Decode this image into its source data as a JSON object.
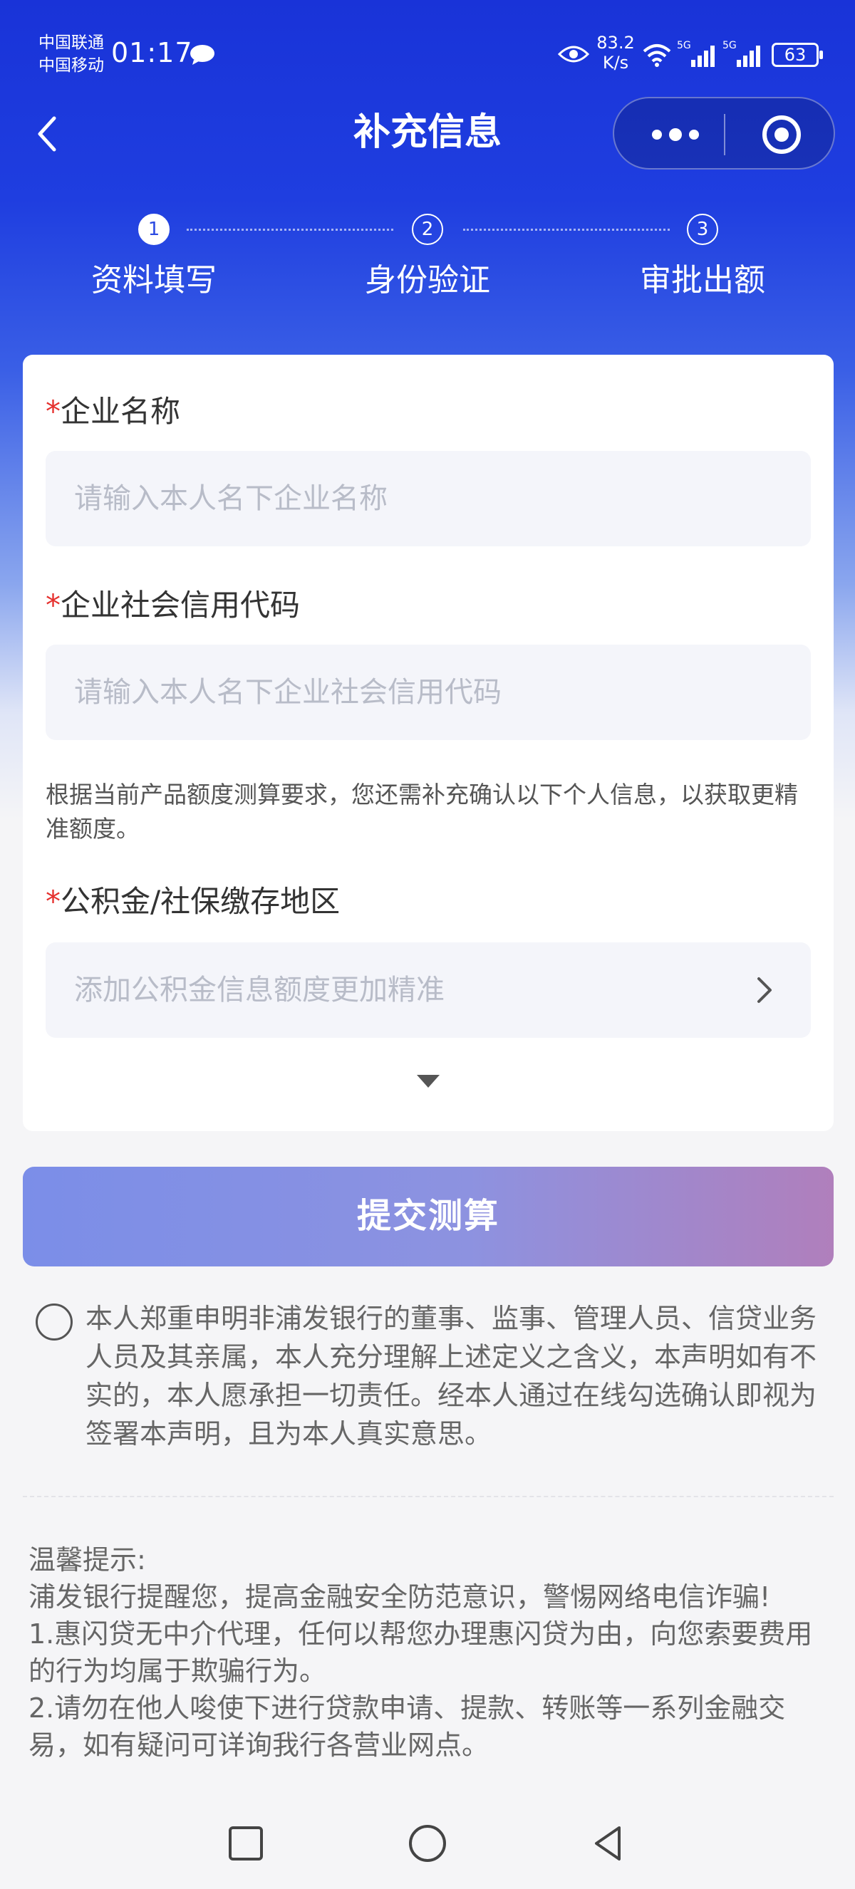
{
  "status_bar": {
    "carrier_1": "中国联通",
    "carrier_2": "中国移动",
    "time": "01:17",
    "speed_value": "83.2",
    "speed_unit": "K/s",
    "network_1": "5G",
    "network_2": "5G",
    "battery": "63"
  },
  "header": {
    "title": "补充信息"
  },
  "steps": [
    {
      "num": "1",
      "label": "资料填写",
      "active": true
    },
    {
      "num": "2",
      "label": "身份验证",
      "active": false
    },
    {
      "num": "3",
      "label": "审批出额",
      "active": false
    }
  ],
  "form": {
    "company_name": {
      "required_mark": "*",
      "label": "企业名称",
      "placeholder": "请输入本人名下企业名称"
    },
    "credit_code": {
      "required_mark": "*",
      "label": "企业社会信用代码",
      "placeholder": "请输入本人名下企业社会信用代码"
    },
    "note": "根据当前产品额度测算要求，您还需补充确认以下个人信息，以获取更精准额度。",
    "region": {
      "required_mark": "*",
      "label": "公积金/社保缴存地区",
      "placeholder": "添加公积金信息额度更加精准"
    }
  },
  "submit_label": "提交测算",
  "agreement": {
    "checked": false,
    "text": "本人郑重申明非浦发银行的董事、监事、管理人员、信贷业务人员及其亲属，本人充分理解上述定义之含义，本声明如有不实的，本人愿承担一切责任。经本人通过在线勾选确认即视为签署本声明，且为本人真实意思。"
  },
  "tips": {
    "heading": "温馨提示:",
    "line_1": "浦发银行提醒您，提高金融安全防范意识，警惕网络电信诈骗!",
    "line_2": "1.惠闪贷无中介代理，任何以帮您办理惠闪贷为由，向您索要费用的行为均属于欺骗行为。",
    "line_3": "2.请勿在他人唆使下进行贷款申请、提款、转账等一系列金融交易，如有疑问可详询我行各营业网点。"
  },
  "colors": {
    "brand_blue": "#1933d8",
    "required_red": "#e5312e",
    "submit_gradient_start": "#7b8ee8",
    "submit_gradient_end": "#b07fbc"
  }
}
